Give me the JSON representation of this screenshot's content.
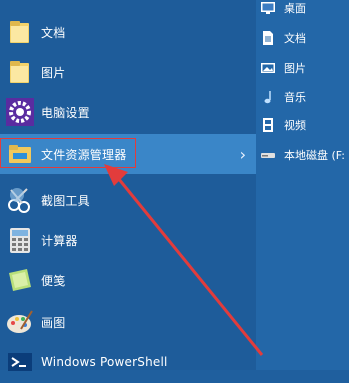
{
  "start_menu": {
    "items": [
      {
        "label": "文档",
        "icon": "folder-icon"
      },
      {
        "label": "图片",
        "icon": "folder-icon"
      },
      {
        "label": "电脑设置",
        "icon": "gear-icon"
      },
      {
        "label": "文件资源管理器",
        "icon": "file-explorer-icon",
        "has_submenu": true,
        "chevron": "›"
      },
      {
        "label": "截图工具",
        "icon": "scissors-icon"
      },
      {
        "label": "计算器",
        "icon": "calculator-icon"
      },
      {
        "label": "便笺",
        "icon": "sticky-notes-icon"
      },
      {
        "label": "画图",
        "icon": "paint-palette-icon"
      },
      {
        "label": "Windows PowerShell",
        "icon": "powershell-icon"
      }
    ]
  },
  "jump_list": {
    "items": [
      {
        "label": "桌面",
        "icon": "desktop-icon"
      },
      {
        "label": "文档",
        "icon": "document-icon"
      },
      {
        "label": "图片",
        "icon": "picture-icon"
      },
      {
        "label": "音乐",
        "icon": "music-icon"
      },
      {
        "label": "视频",
        "icon": "video-icon"
      },
      {
        "label": "本地磁盘 (F:",
        "icon": "drive-icon"
      }
    ]
  },
  "colors": {
    "background": "#1f5f9e",
    "highlight": "#3a86c8",
    "annotation_red": "#e23c3c"
  }
}
